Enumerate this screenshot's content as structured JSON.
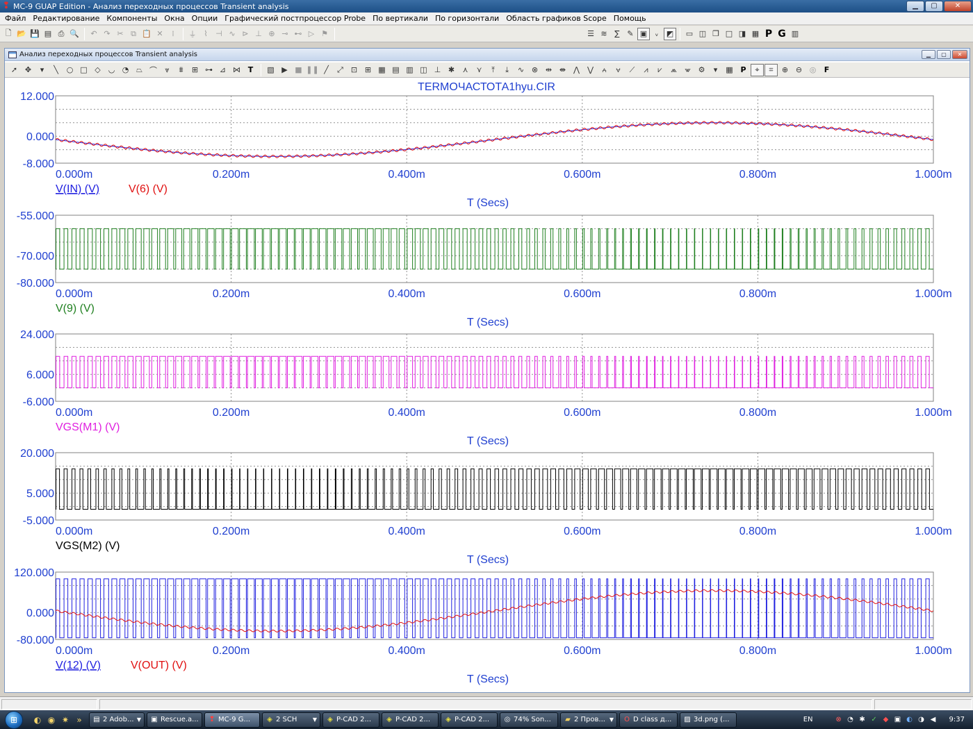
{
  "window": {
    "title": "MC-9 GUAP Edition - Анализ переходных процессов Transient analysis",
    "controls": [
      "minimize",
      "maximize",
      "close"
    ]
  },
  "menu": [
    "Файл",
    "Редактирование",
    "Компоненты",
    "Окна",
    "Опции",
    "Графический постпроцессор Probe",
    "По вертикали",
    "По горизонтали",
    "Область графиков Scope",
    "Помощь"
  ],
  "toolbar_text": {
    "p": "P",
    "g": "G"
  },
  "child_window": {
    "title": "Анализ переходных процессов Transient analysis"
  },
  "child_toolbar_text": {
    "text_tool": "T",
    "p": "P",
    "f": "F"
  },
  "status_bar": {
    "cells": [
      "",
      "",
      ""
    ]
  },
  "taskbar": {
    "tasks": [
      {
        "label": "2 Adob...",
        "icon": "pdf-icon"
      },
      {
        "label": "Rescue.a...",
        "icon": "app-icon"
      },
      {
        "label": "MC-9 G...",
        "icon": "mc9-icon",
        "active": true
      },
      {
        "label": "2 SCH",
        "icon": "pcad-icon"
      },
      {
        "label": "P-CAD 2...",
        "icon": "pcad-icon"
      },
      {
        "label": "P-CAD 2...",
        "icon": "pcad-icon"
      },
      {
        "label": "P-CAD 2...",
        "icon": "pcad-icon"
      },
      {
        "label": "74% Son...",
        "icon": "disc-icon"
      },
      {
        "label": "2 Пров...",
        "icon": "folder-icon"
      },
      {
        "label": "D class д...",
        "icon": "opera-icon"
      },
      {
        "label": "3d.png (...",
        "icon": "image-icon"
      }
    ],
    "language": "EN",
    "clock": "9:37"
  },
  "chart_data": [
    {
      "type": "line",
      "title": "TERMOЧАСТОТА1hyu.CIR",
      "xlabel": "T (Secs)",
      "x_ticks": [
        "0.000m",
        "0.200m",
        "0.400m",
        "0.600m",
        "0.800m",
        "1.000m"
      ],
      "xlim": [
        0,
        1.0
      ],
      "y_ticks": [
        "12.000",
        "0.000",
        "-8.000"
      ],
      "ylim": [
        -8,
        12
      ],
      "grid": true,
      "series": [
        {
          "name": "V(IN) (V)",
          "color": "#2020e0",
          "kind": "sine",
          "amplitude": 5,
          "period": 1.0,
          "offset": -1
        },
        {
          "name": "V(6) (V)",
          "color": "#e01010",
          "kind": "sine-ripple",
          "amplitude": 5,
          "period": 1.0,
          "offset": -1,
          "ripple": 0.4
        }
      ]
    },
    {
      "type": "line",
      "xlabel": "T (Secs)",
      "x_ticks": [
        "0.000m",
        "0.200m",
        "0.400m",
        "0.600m",
        "0.800m",
        "1.000m"
      ],
      "xlim": [
        0,
        1.0
      ],
      "y_ticks": [
        "-55.000",
        "-70.000",
        "-80.000"
      ],
      "ylim": [
        -80,
        -55
      ],
      "grid": true,
      "series": [
        {
          "name": "V(9) (V)",
          "color": "#208020",
          "kind": "pwm",
          "high": -60,
          "low": -75,
          "pulses": 110,
          "phase": 0
        }
      ]
    },
    {
      "type": "line",
      "xlabel": "T (Secs)",
      "x_ticks": [
        "0.000m",
        "0.200m",
        "0.400m",
        "0.600m",
        "0.800m",
        "1.000m"
      ],
      "xlim": [
        0,
        1.0
      ],
      "y_ticks": [
        "24.000",
        "6.000",
        "-6.000"
      ],
      "ylim": [
        -6,
        24
      ],
      "grid": true,
      "series": [
        {
          "name": "VGS(M1) (V)",
          "color": "#e020e0",
          "kind": "pwm",
          "high": 14,
          "low": 0,
          "pulses": 110,
          "phase": 0
        }
      ]
    },
    {
      "type": "line",
      "xlabel": "T (Secs)",
      "x_ticks": [
        "0.000m",
        "0.200m",
        "0.400m",
        "0.600m",
        "0.800m",
        "1.000m"
      ],
      "xlim": [
        0,
        1.0
      ],
      "y_ticks": [
        "20.000",
        "5.000",
        "-5.000"
      ],
      "ylim": [
        -5,
        20
      ],
      "grid": true,
      "series": [
        {
          "name": "VGS(M2) (V)",
          "color": "#000000",
          "kind": "pwm",
          "high": 14,
          "low": -1,
          "pulses": 110,
          "phase": 0.5
        }
      ]
    },
    {
      "type": "line",
      "xlabel": "T (Secs)",
      "x_ticks": [
        "0.000m",
        "0.200m",
        "0.400m",
        "0.600m",
        "0.800m",
        "1.000m"
      ],
      "xlim": [
        0,
        1.0
      ],
      "y_ticks": [
        "120.000",
        "0.000",
        "-80.000"
      ],
      "ylim": [
        -80,
        120
      ],
      "grid": true,
      "series": [
        {
          "name": "V(12) (V)",
          "color": "#2020e0",
          "kind": "pwm",
          "high": 100,
          "low": -75,
          "pulses": 110,
          "phase": 0
        },
        {
          "name": "V(OUT) (V)",
          "color": "#e01010",
          "kind": "sine-ripple",
          "amplitude": 60,
          "period": 1.0,
          "offset": 5,
          "ripple": 3
        }
      ]
    }
  ]
}
